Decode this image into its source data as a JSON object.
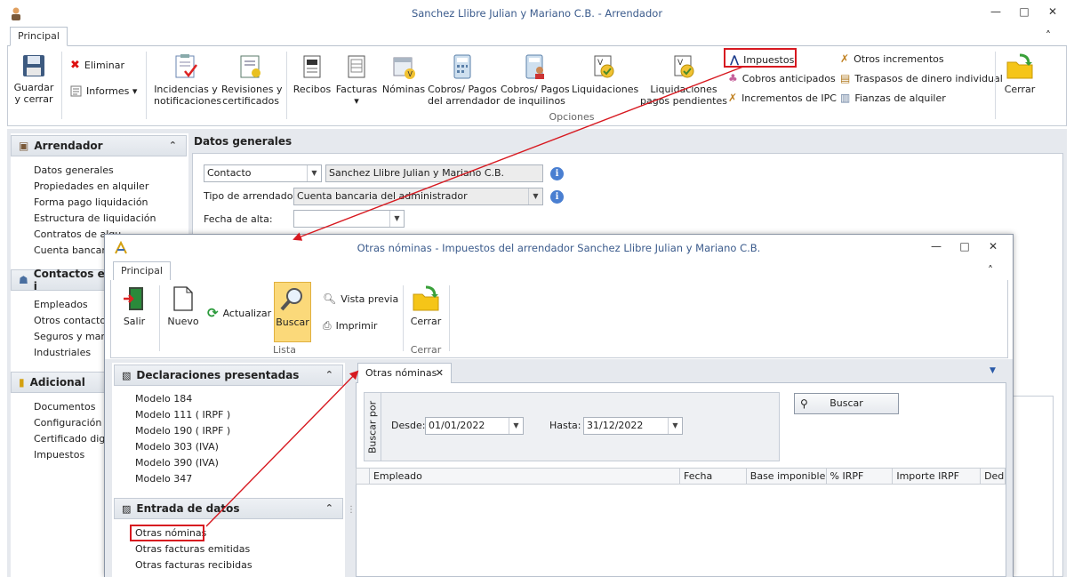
{
  "main": {
    "title": "Sanchez Llibre Julian y Mariano C.B. - Arrendador",
    "window_controls": {
      "minimize": "—",
      "maximize": "□",
      "close": "✕"
    },
    "tab": "Principal",
    "collapse": "˄",
    "ribbon": {
      "guardar": "Guardar\ny cerrar",
      "eliminar": "Eliminar",
      "informes": "Informes ▾",
      "incidencias": "Incidencias y\nnotificaciones",
      "revisiones": "Revisiones y\ncertificados",
      "recibos": "Recibos",
      "facturas": "Facturas",
      "facturas_arrow": "▾",
      "nominas": "Nóminas",
      "cobros_arr": "Cobros/ Pagos\ndel arrendador",
      "cobros_inq": "Cobros/ Pagos\nde inquilinos",
      "liquidaciones": "Liquidaciones",
      "liq_pend": "Liquidaciones\npagos pendientes",
      "impuestos": "Impuestos",
      "cobros_ant": "Cobros anticipados",
      "incrementos_ipc": "Incrementos de IPC",
      "otros_incr": "Otros incrementos",
      "traspasos": "Traspasos de dinero individual",
      "fianzas": "Fianzas de alquiler",
      "opciones": "Opciones",
      "cerrar": "Cerrar"
    },
    "sidebar": {
      "arrendador": "Arrendador",
      "arrendador_items": [
        "Datos generales",
        "Propiedades en alquiler",
        "Forma pago liquidación",
        "Estructura de liquidación",
        "Contratos de alqu",
        "Cuenta bancaria"
      ],
      "contactos": "Contactos e i",
      "contactos_items": [
        "Empleados",
        "Otros contactos",
        "Seguros y mante",
        "Industriales"
      ],
      "adicional": "Adicional",
      "adicional_items": [
        "Documentos",
        "Configuración",
        "Certificado digita",
        "Impuestos"
      ]
    },
    "datos": {
      "header": "Datos generales",
      "contacto_label": "Contacto",
      "contacto_value": "Sanchez Llibre Julian y Mariano C.B.",
      "tipo_label": "Tipo de arrendador:",
      "tipo_value": "Cuenta bancaria del administrador",
      "fecha_label": "Fecha de alta:",
      "info": "i"
    }
  },
  "child": {
    "title": "Otras nóminas - Impuestos del arrendador Sanchez Llibre Julian y Mariano C.B.",
    "tab": "Principal",
    "ribbon": {
      "salir": "Salir",
      "nuevo": "Nuevo",
      "actualizar": "Actualizar",
      "buscar": "Buscar",
      "vista_previa": "Vista previa",
      "imprimir": "Imprimir",
      "lista": "Lista",
      "cerrar": "Cerrar",
      "cerrar_grp": "Cerrar"
    },
    "declaraciones": {
      "header": "Declaraciones presentadas",
      "items": [
        "Modelo 184",
        "Modelo 111 ( IRPF )",
        "Modelo 190 ( IRPF )",
        "Modelo 303 (IVA)",
        "Modelo 390 (IVA)",
        "Modelo 347"
      ]
    },
    "entrada": {
      "header": "Entrada de datos",
      "items": [
        "Otras nóminas",
        "Otras facturas emitidas",
        "Otras facturas recibidas"
      ]
    },
    "doc_tab": "Otras nóminas",
    "doc_tab_close": "✕",
    "doc_menu": "▼",
    "search": {
      "group": "Buscar por",
      "desde_label": "Desde:",
      "desde_value": "01/01/2022",
      "hasta_label": "Hasta:",
      "hasta_value": "31/12/2022",
      "button": "Buscar"
    },
    "grid_columns": [
      "Empleado",
      "Fecha",
      "Base imponible",
      "% IRPF",
      "Importe IRPF",
      "Ded"
    ]
  },
  "colors": {
    "highlight": "#d71920",
    "accent": "#3b5b8c"
  }
}
